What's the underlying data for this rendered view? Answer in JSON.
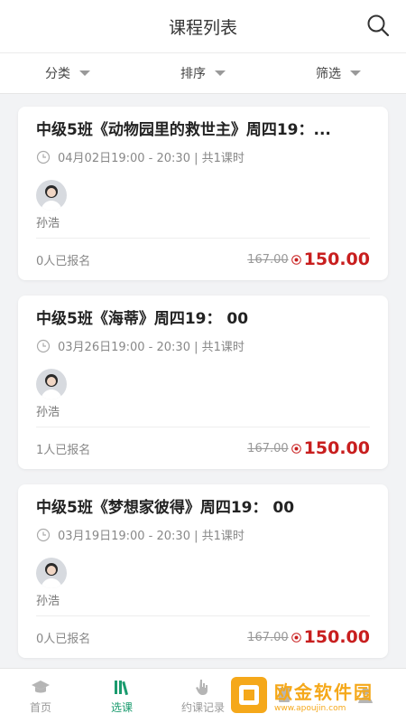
{
  "header": {
    "title": "课程列表"
  },
  "filters": [
    {
      "label": "分类"
    },
    {
      "label": "排序"
    },
    {
      "label": "筛选"
    }
  ],
  "courses": [
    {
      "title": "中级5班《动物园里的救世主》周四19：...",
      "time": "04月02日19:00 - 20:30 | 共1课时",
      "teacher": "孙浩",
      "enrolled": "0人已报名",
      "original_price": "167.00",
      "price": "150.00"
    },
    {
      "title": "中级5班《海蒂》周四19： 00",
      "time": "03月26日19:00 - 20:30 | 共1课时",
      "teacher": "孙浩",
      "enrolled": "1人已报名",
      "original_price": "167.00",
      "price": "150.00"
    },
    {
      "title": "中级5班《梦想家彼得》周四19： 00",
      "time": "03月19日19:00 - 20:30 | 共1课时",
      "teacher": "孙浩",
      "enrolled": "0人已报名",
      "original_price": "167.00",
      "price": "150.00"
    }
  ],
  "tabbar": [
    {
      "label": "首页",
      "icon": "graduation-cap-icon",
      "active": false
    },
    {
      "label": "选课",
      "icon": "books-icon",
      "active": true
    },
    {
      "label": "约课记录",
      "icon": "hand-pointer-icon",
      "active": false
    },
    {
      "label": "",
      "icon": "book-icon",
      "active": false
    },
    {
      "label": "",
      "icon": "user-icon",
      "active": false
    }
  ],
  "watermark": {
    "name": "欧金软件园",
    "url": "www.apoujin.com"
  },
  "colors": {
    "accent": "#1a9b6e",
    "price": "#c81e1e",
    "background": "#f2f3f5"
  }
}
